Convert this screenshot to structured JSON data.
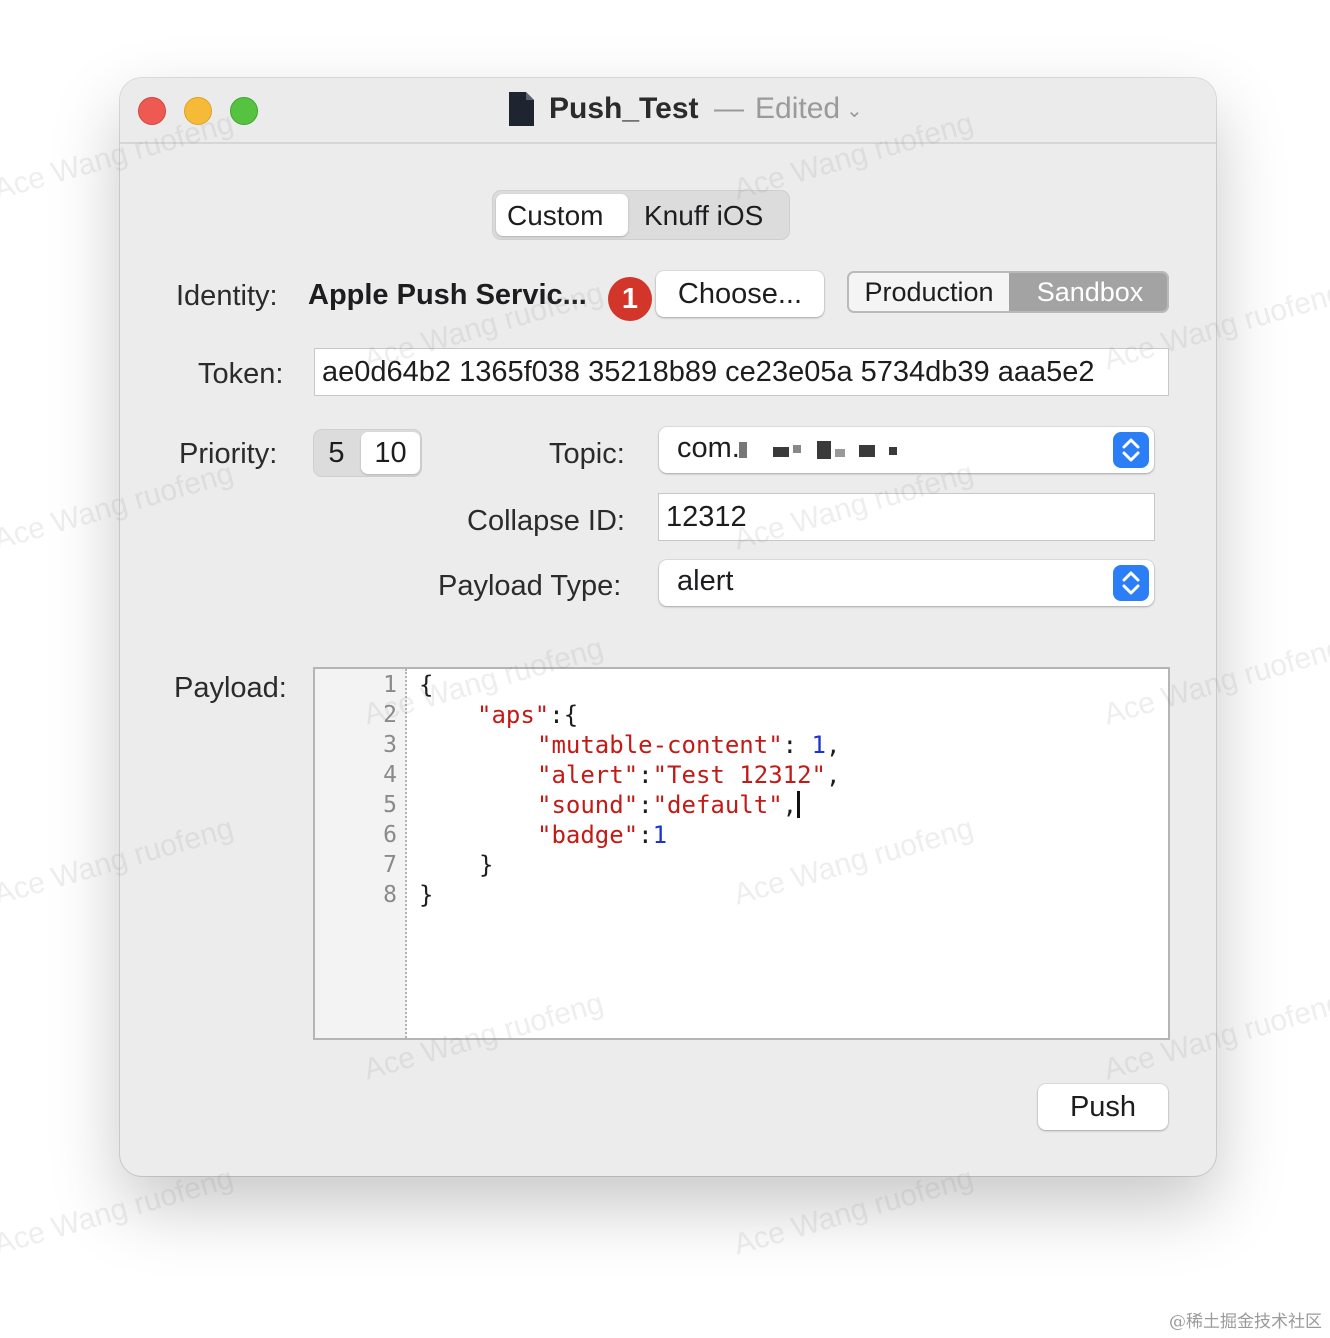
{
  "window": {
    "title": "Push_Test",
    "title_separator": "—",
    "title_status": "Edited",
    "chevron": "⌄"
  },
  "tabs": {
    "items": [
      "Custom",
      "Knuff iOS"
    ],
    "selected": "Custom"
  },
  "identity": {
    "label": "Identity:",
    "value": "Apple Push Servic...",
    "badge": "1",
    "choose_button": "Choose...",
    "environments": [
      "Production",
      "Sandbox"
    ],
    "selected_environment": "Sandbox"
  },
  "token": {
    "label": "Token:",
    "value": "ae0d64b2 1365f038 35218b89 ce23e05a 5734db39 aaa5e2"
  },
  "priority": {
    "label": "Priority:",
    "options": [
      "5",
      "10"
    ],
    "selected": "10"
  },
  "topic": {
    "label": "Topic:",
    "value": "com."
  },
  "collapse_id": {
    "label": "Collapse ID:",
    "value": "12312"
  },
  "payload_type": {
    "label": "Payload Type:",
    "value": "alert"
  },
  "payload": {
    "label": "Payload:",
    "line_numbers": [
      "1",
      "2",
      "3",
      "4",
      "5",
      "6",
      "7",
      "8"
    ],
    "tokens": {
      "l1": "{",
      "l2_key": "\"aps\"",
      "l2_rest": ":{",
      "l3_key": "\"mutable-content\"",
      "l3_sep": ": ",
      "l3_val": "1",
      "l3_end": ",",
      "l4_key": "\"alert\"",
      "l4_sep": ":",
      "l4_val": "\"Test 12312\"",
      "l4_end": ",",
      "l5_key": "\"sound\"",
      "l5_sep": ":",
      "l5_val": "\"default\"",
      "l5_end": ",",
      "l6_key": "\"badge\"",
      "l6_sep": ":",
      "l6_val": "1",
      "l7": "}",
      "l8": "}"
    }
  },
  "push_button": "Push",
  "watermark": "Ace Wang ruofeng",
  "footer_watermark": "@稀土掘金技术社区",
  "colors": {
    "close": "#ee5a51",
    "minimize": "#f6bb36",
    "maximize": "#55c33f",
    "accent": "#2c7ef6",
    "badge": "#d2352a",
    "json_key": "#c41a16",
    "json_number": "#1c31d6"
  }
}
